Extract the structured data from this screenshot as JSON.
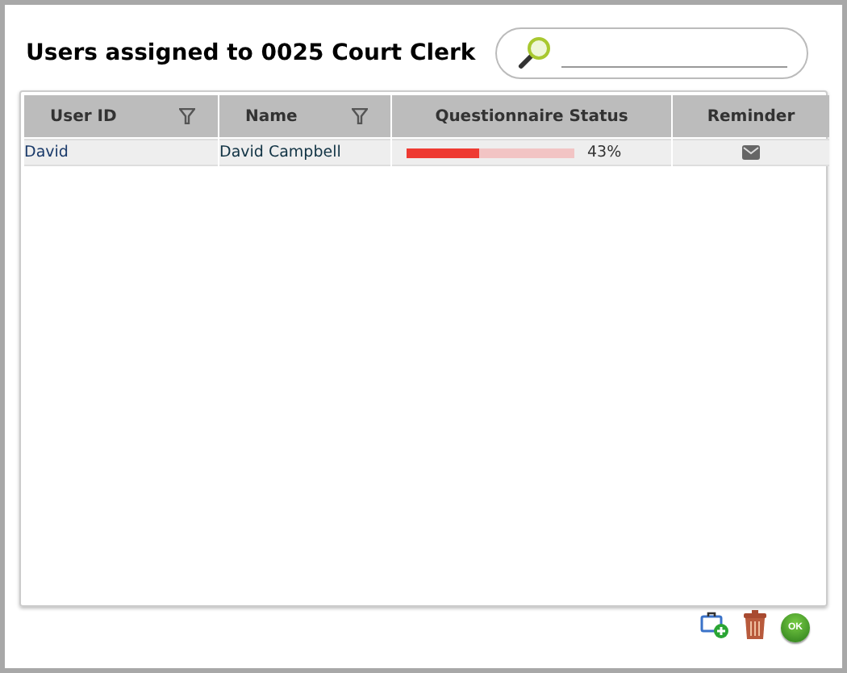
{
  "title": "Users assigned to 0025 Court Clerk",
  "table": {
    "columns": [
      {
        "label": "User ID",
        "filter": true
      },
      {
        "label": "Name",
        "filter": true
      },
      {
        "label": "Questionnaire Status",
        "filter": false
      },
      {
        "label": "Reminder",
        "filter": false
      }
    ],
    "rows": [
      {
        "user_id": "David",
        "name": "David Campbell",
        "level": 0.43,
        "reading": "43%",
        "selected": false
      }
    ]
  },
  "actions": {
    "ok_label": "OK"
  }
}
